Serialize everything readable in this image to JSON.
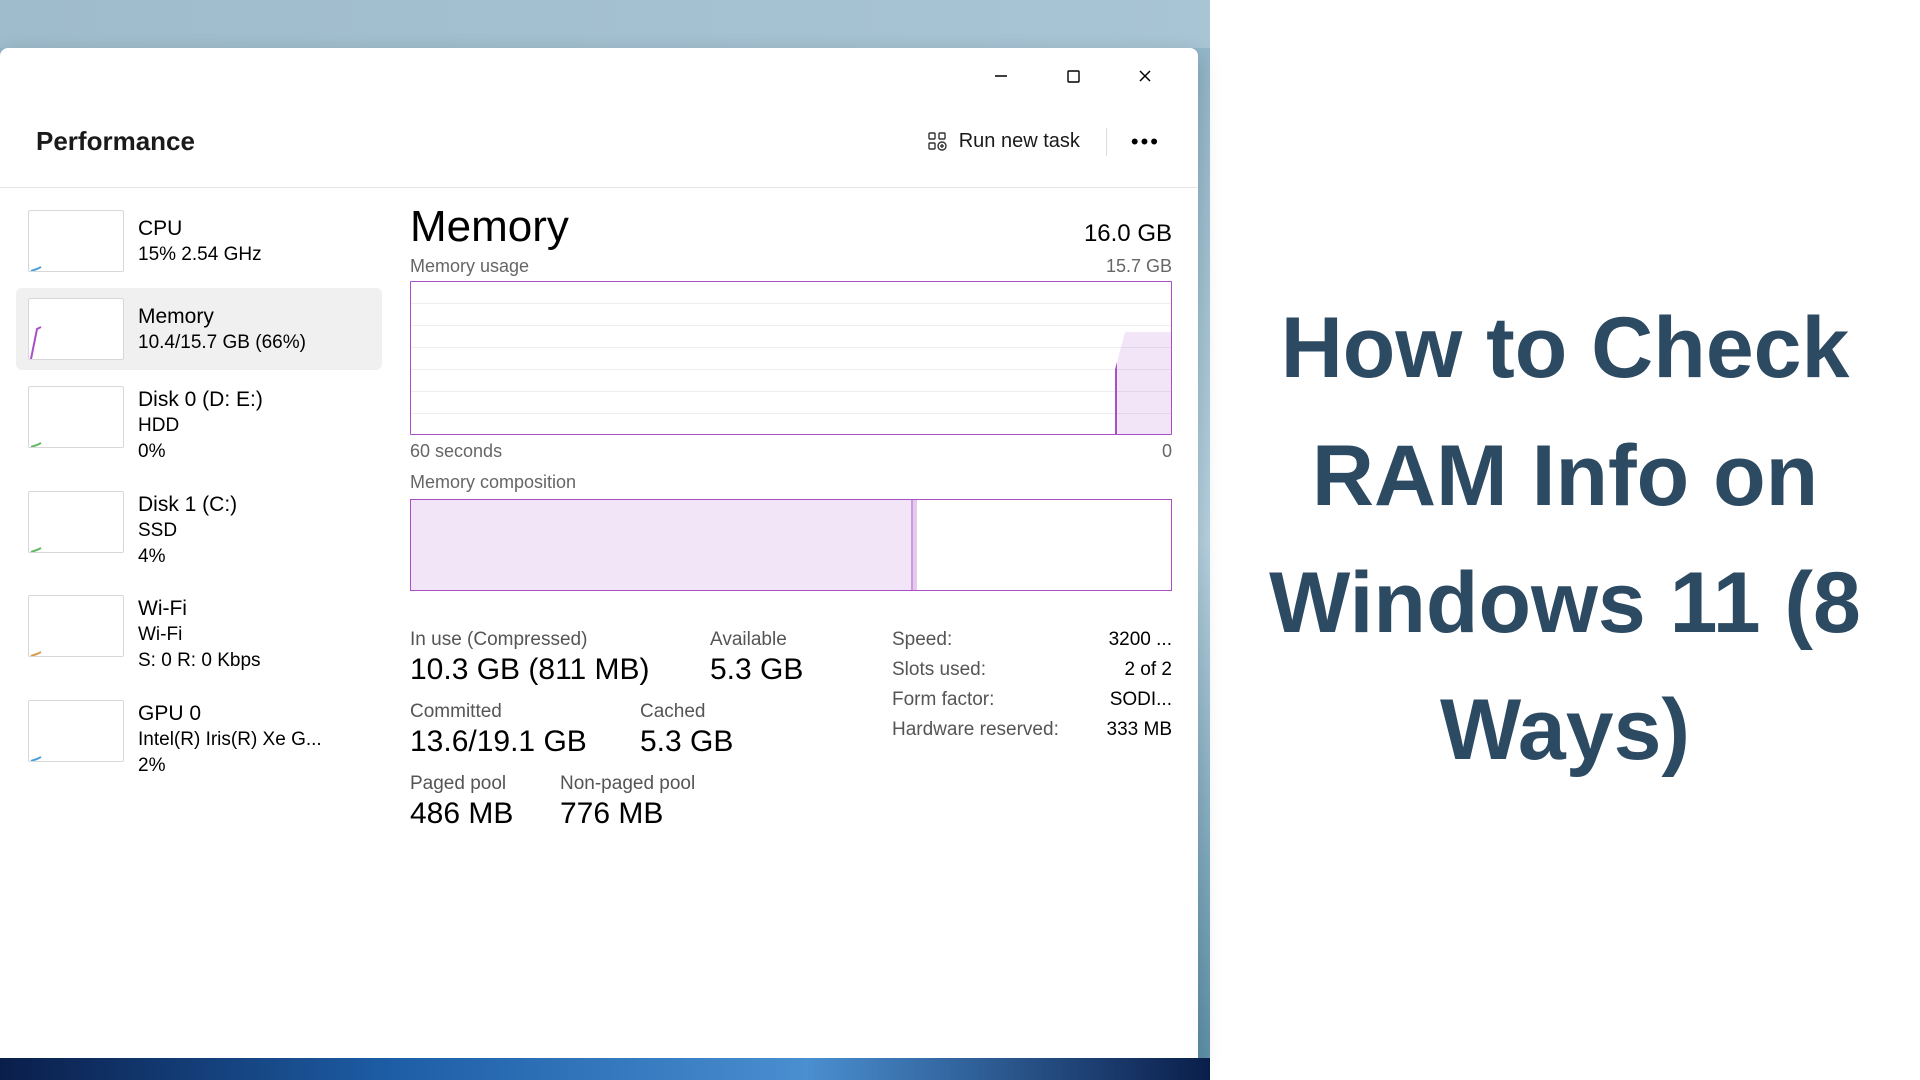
{
  "article": {
    "headline": "How to Check RAM Info on Windows 11 (8 Ways)"
  },
  "window": {
    "header": {
      "title": "Performance",
      "runTask": "Run new task"
    },
    "sidebar": [
      {
        "title": "CPU",
        "sub": "15% 2.54 GHz",
        "color": "#4a9fd8"
      },
      {
        "title": "Memory",
        "sub": "10.4/15.7 GB (66%)",
        "color": "#a84fc8",
        "selected": true
      },
      {
        "title": "Disk 0 (D: E:)",
        "sub1": "HDD",
        "sub2": "0%",
        "color": "#5fb85f"
      },
      {
        "title": "Disk 1 (C:)",
        "sub1": "SSD",
        "sub2": "4%",
        "color": "#5fb85f"
      },
      {
        "title": "Wi-Fi",
        "sub1": "Wi-Fi",
        "sub2": "S: 0 R: 0 Kbps",
        "color": "#d89a4a"
      },
      {
        "title": "GPU 0",
        "sub1": "Intel(R) Iris(R) Xe G...",
        "sub2": "2%",
        "color": "#4a9fd8"
      }
    ],
    "main": {
      "title": "Memory",
      "total": "16.0 GB",
      "usageLabel": "Memory usage",
      "usageMax": "15.7 GB",
      "axisLeft": "60 seconds",
      "axisRight": "0",
      "compLabel": "Memory composition",
      "compUsedPercent": 66,
      "stats": {
        "inUseLabel": "In use (Compressed)",
        "inUse": "10.3 GB (811 MB)",
        "availableLabel": "Available",
        "available": "5.3 GB",
        "committedLabel": "Committed",
        "committed": "13.6/19.1 GB",
        "cachedLabel": "Cached",
        "cached": "5.3 GB",
        "pagedLabel": "Paged pool",
        "paged": "486 MB",
        "nonpagedLabel": "Non-paged pool",
        "nonpaged": "776 MB"
      },
      "details": [
        {
          "k": "Speed:",
          "v": "3200 ..."
        },
        {
          "k": "Slots used:",
          "v": "2 of 2"
        },
        {
          "k": "Form factor:",
          "v": "SODI..."
        },
        {
          "k": "Hardware reserved:",
          "v": "333 MB"
        }
      ]
    }
  },
  "chart_data": {
    "type": "line",
    "title": "Memory usage",
    "xlabel": "seconds",
    "ylabel": "GB",
    "x_range": [
      60,
      0
    ],
    "ylim": [
      0,
      15.7
    ],
    "series": [
      {
        "name": "Memory",
        "x": [
          60,
          6,
          5,
          4,
          3,
          2,
          1,
          0
        ],
        "values": [
          0,
          0,
          6.5,
          10.3,
          10.3,
          10.3,
          10.3,
          10.3
        ]
      }
    ],
    "composition": {
      "type": "bar",
      "categories": [
        "In use",
        "Available"
      ],
      "values": [
        10.3,
        5.3
      ],
      "total": 15.7
    }
  }
}
